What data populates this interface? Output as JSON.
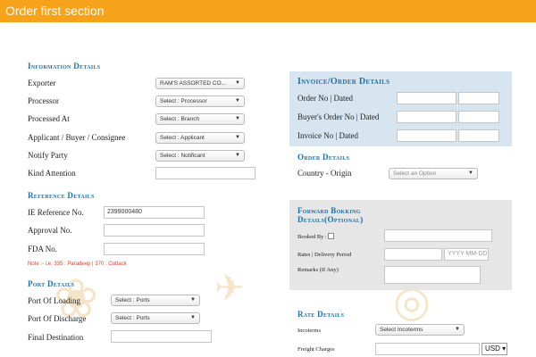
{
  "header": {
    "title": "Order first section"
  },
  "info": {
    "title": "Information Details",
    "exporter_label": "Exporter",
    "exporter_value": "RAM'S ASSORTED CO...",
    "processor_label": "Processor",
    "processor_value": "Select : Processor",
    "processed_at_label": "Processed At",
    "processed_at_value": "Select : Branch",
    "applicant_label": "Applicant / Buyer / Consignee",
    "applicant_value": "Select : Applicant",
    "notify_label": "Notify Party",
    "notify_value": "Select : Notificant",
    "kind_attention_label": "Kind Attention",
    "kind_attention_value": ""
  },
  "reference": {
    "title": "Reference Details",
    "ie_label": "IE Reference No.",
    "ie_value": "2399000480",
    "approval_label": "Approval No.",
    "approval_value": "",
    "fda_label": "FDA No.",
    "fda_value": "",
    "note": "Note :- i.e. 335 : Paradeep | 370 : Cuttack"
  },
  "port": {
    "title": "Port Details",
    "loading_label": "Port Of Loading",
    "loading_value": "Select : Ports",
    "discharge_label": "Port Of Discharge",
    "discharge_value": "Select : Ports",
    "final_label": "Final Destination",
    "final_value": ""
  },
  "invoice": {
    "title": "Invoice/Order Details",
    "order_label": "Order No | Dated",
    "buyer_order_label": "Buyer's Order No | Dated",
    "invoice_label": "Invoice No | Dated"
  },
  "order": {
    "title": "Order Details",
    "country_label": "Country - Origin",
    "country_value": "Select an Option"
  },
  "forward": {
    "title_line1": "Forward Bokking",
    "title_line2": "Details(Optional)",
    "booked_label": "Booked By :",
    "rates_label": "Rates | Delivery Period",
    "date_placeholder": "YYYY-MM-DD",
    "remarks_label": "Remarks (If Any)"
  },
  "rate": {
    "title": "Rate Details",
    "incoterms_label": "Incoterms",
    "incoterms_value": "Select Incoterms",
    "freight_label": "Freight Charges",
    "currency_value": "USD ▾"
  }
}
